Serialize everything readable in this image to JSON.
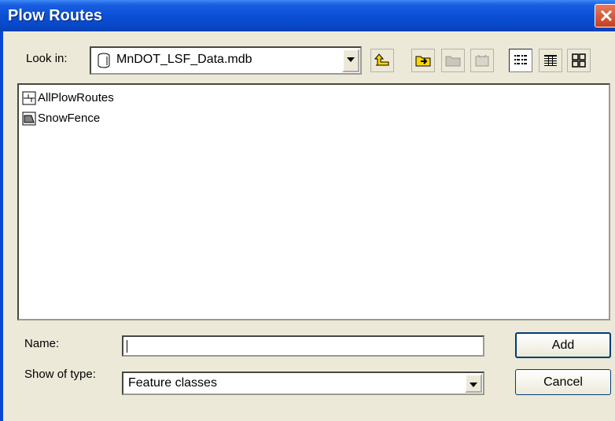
{
  "window": {
    "title": "Plow Routes",
    "close_icon": "close-icon"
  },
  "lookin": {
    "label": "Look in:",
    "value": "MnDOT_LSF_Data.mdb",
    "icon": "database-icon"
  },
  "toolbar": {
    "buttons": [
      {
        "name": "up-one-level-icon"
      },
      {
        "name": "connect-folder-icon"
      },
      {
        "name": "disconnect-folder-icon"
      },
      {
        "name": "catalog-options-icon"
      },
      {
        "name": "list-view-icon"
      },
      {
        "name": "details-view-icon"
      },
      {
        "name": "thumbnails-view-icon"
      }
    ]
  },
  "files": [
    {
      "label": "AllPlowRoutes",
      "icon": "line-feature-class-icon"
    },
    {
      "label": "SnowFence",
      "icon": "polygon-feature-class-icon"
    }
  ],
  "form": {
    "name_label": "Name:",
    "name_value": "",
    "type_label": "Show of type:",
    "type_value": "Feature classes",
    "add_label": "Add",
    "cancel_label": "Cancel"
  },
  "colors": {
    "titlebar": "#0a4fd6",
    "close": "#d9532f",
    "face": "#ece9d8"
  }
}
